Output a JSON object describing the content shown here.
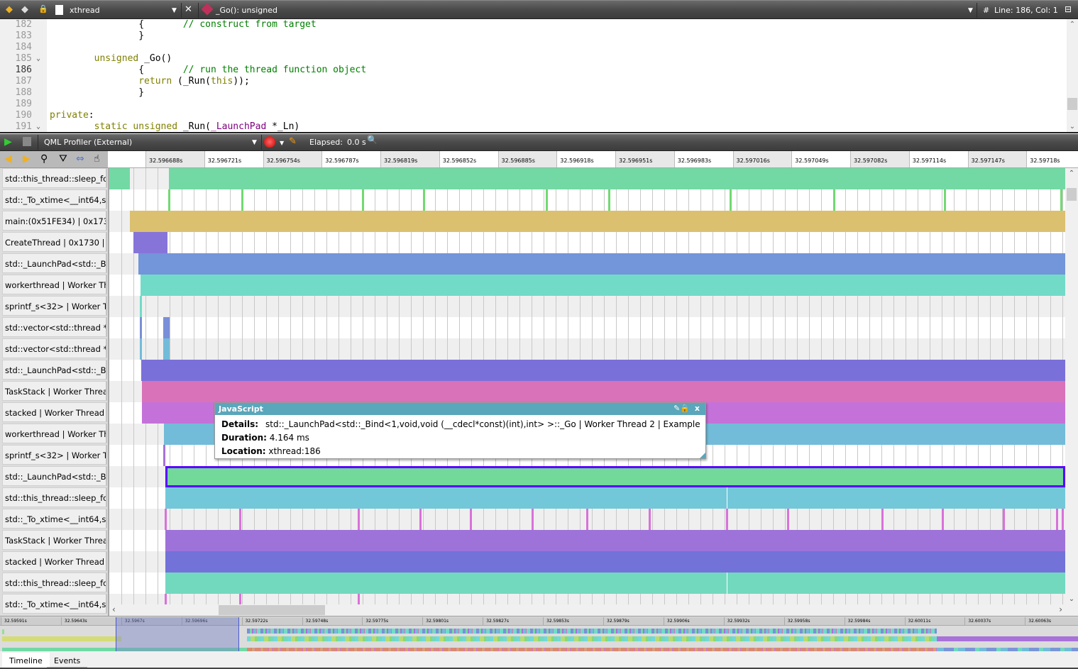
{
  "editor": {
    "file_name": "xthread",
    "symbol": "_Go(): unsigned",
    "position": "Line: 186, Col: 1",
    "hash": "#",
    "lines": [
      {
        "n": "182",
        "fold": false,
        "seg": [
          [
            "",
            "                "
          ],
          [
            "",
            "{"
          ],
          [
            "",
            "       "
          ],
          [
            "cm",
            "// construct from target"
          ]
        ]
      },
      {
        "n": "183",
        "fold": false,
        "seg": [
          [
            "",
            "                "
          ],
          [
            "",
            "}"
          ]
        ]
      },
      {
        "n": "184",
        "fold": false,
        "seg": []
      },
      {
        "n": "185",
        "fold": true,
        "seg": [
          [
            "",
            "        "
          ],
          [
            "kw",
            "unsigned"
          ],
          [
            "",
            " _Go()"
          ]
        ]
      },
      {
        "n": "186",
        "fold": false,
        "seg": [
          [
            "",
            "                "
          ],
          [
            "",
            "{"
          ],
          [
            "",
            "       "
          ],
          [
            "cm",
            "// run the thread function object"
          ]
        ]
      },
      {
        "n": "187",
        "fold": false,
        "seg": [
          [
            "",
            "                "
          ],
          [
            "kw",
            "return"
          ],
          [
            "",
            " (_Run("
          ],
          [
            "kw",
            "this"
          ],
          [
            "",
            "));"
          ]
        ]
      },
      {
        "n": "188",
        "fold": false,
        "seg": [
          [
            "",
            "                "
          ],
          [
            "",
            "}"
          ]
        ]
      },
      {
        "n": "189",
        "fold": false,
        "seg": []
      },
      {
        "n": "190",
        "fold": false,
        "seg": [
          [
            "kw",
            "private"
          ],
          [
            "",
            ":"
          ]
        ]
      },
      {
        "n": "191",
        "fold": true,
        "seg": [
          [
            "",
            "        "
          ],
          [
            "kw",
            "static unsigned"
          ],
          [
            "",
            " _Run("
          ],
          [
            "ty",
            "_LaunchPad"
          ],
          [
            "",
            " *_Ln)"
          ]
        ]
      }
    ]
  },
  "profiler": {
    "title": "QML Profiler (External)",
    "elapsed_label": "Elapsed:",
    "elapsed_value": "0.0 s",
    "ticks": [
      "56s",
      "32.596688s",
      "32.596721s",
      "32.596754s",
      "32.596787s",
      "32.596819s",
      "32.596852s",
      "32.596885s",
      "32.596918s",
      "32.596951s",
      "32.596983s",
      "32.597016s",
      "32.597049s",
      "32.597082s",
      "32.597114s",
      "32.597147s",
      "32.59718s"
    ],
    "rows": [
      {
        "label": "std::this_thread::sleep_for...",
        "color": "#72d9a4",
        "bars": [
          [
            32.5966677,
            32.5966792
          ],
          [
            32.5967012,
            32.597205
          ]
        ]
      },
      {
        "label": "std::_To_xtime<__int64,st...",
        "color": "#72d972",
        "marks": [
          32.5967012,
          32.5967422,
          32.59681,
          32.5968443,
          32.5969133,
          32.5969484,
          32.5970166,
          32.5970748,
          32.597137,
          32.5972025
        ]
      },
      {
        "label": "main:(0x51FE34) | 0x1730 ...",
        "color": "#dbc070",
        "bars": [
          [
            32.5966792,
            32.597205
          ]
        ]
      },
      {
        "label": "CreateThread | 0x1730 | E...",
        "color": "#8674d9",
        "bars": [
          [
            32.5966812,
            32.5967004
          ]
        ]
      },
      {
        "label": "std::_LaunchPad<std::_Bin...",
        "color": "#7395d9",
        "bars": [
          [
            32.596684,
            32.597205
          ]
        ]
      },
      {
        "label": "workerthread | Worker Thr...",
        "color": "#72dbc8",
        "bars": [
          [
            32.5966852,
            32.597205
          ]
        ]
      },
      {
        "label": "sprintf_s<32> | Worker Th...",
        "color": "#72dbc8",
        "marks": [
          32.5966852
        ]
      },
      {
        "label": "std::vector<std::thread *,...",
        "color": "#7a8fd9",
        "marks": [
          32.5966852,
          32.5966984,
          32.5966996,
          32.5967008
        ]
      },
      {
        "label": "std::vector<std::thread *,...",
        "color": "#72bcd9",
        "marks": [
          32.5966852,
          32.5966984,
          32.5966996,
          32.5967008
        ]
      },
      {
        "label": "std::_LaunchPad<std::_Bin...",
        "color": "#7a70d9",
        "bars": [
          [
            32.5966856,
            32.597205
          ]
        ]
      },
      {
        "label": "TaskStack | Worker Thread...",
        "color": "#d972b8",
        "bars": [
          [
            32.596686,
            32.597205
          ]
        ]
      },
      {
        "label": "stacked | Worker Thread 0 ...",
        "color": "#c472d9",
        "bars": [
          [
            32.596686,
            32.597205
          ]
        ]
      },
      {
        "label": "workerthread | Worker Thr...",
        "color": "#72bcd9",
        "bars": [
          [
            32.5966984,
            32.597205
          ]
        ]
      },
      {
        "label": "sprintf_s<32> | Worker Th...",
        "color": "#a872d9",
        "marks": [
          32.5966984
        ]
      },
      {
        "label": "std::_LaunchPad<std::_Bin...",
        "color": "#72d99a",
        "selected": true,
        "bars": [
          [
            32.5966992,
            32.597205
          ]
        ]
      },
      {
        "label": "std::this_thread::sleep_for...",
        "color": "#72c8d9",
        "bars": [
          [
            32.5966992,
            32.5970146
          ],
          [
            32.597015,
            32.597205
          ]
        ]
      },
      {
        "label": "std::_To_xtime<__int64,st...",
        "color": "#d972d9",
        "marks": [
          32.5966992,
          32.596741,
          32.5968076,
          32.5968423,
          32.5968707,
          32.5969053,
          32.5969361,
          32.5969711,
          32.5970146,
          32.5970489,
          32.597102,
          32.5971359,
          32.5971702,
          32.5972001,
          32.5972033
        ]
      },
      {
        "label": "TaskStack | Worker Thread...",
        "color": "#9d72d9",
        "bars": [
          [
            32.5966992,
            32.597205
          ]
        ]
      },
      {
        "label": "stacked | Worker Thread 1 ...",
        "color": "#7272d9",
        "bars": [
          [
            32.5966992,
            32.597205
          ]
        ]
      },
      {
        "label": "std::this_thread::sleep_for...",
        "color": "#72d9bf",
        "bars": [
          [
            32.5966992,
            32.5970146
          ],
          [
            32.597015,
            32.597205
          ]
        ]
      },
      {
        "label": "std::_To_xtime<__int64,st...",
        "color": "#d972d9",
        "marks": [
          32.5966992,
          32.596741,
          32.5968076
        ]
      }
    ],
    "tooltip": {
      "title": "JavaScript",
      "details_label": "Details:",
      "details": "std::_LaunchPad<std::_Bind<1,void,void (__cdecl*const)(int),int> >::_Go | Worker Thread 2 | Example",
      "duration_label": "Duration:",
      "duration": "4.164 ms",
      "location_label": "Location:",
      "location": "xthread:186",
      "close": "x"
    },
    "overview_ticks": [
      "32.59591s",
      "32.59643s",
      "32.5967s",
      "32.59696s",
      "32.59722s",
      "32.59748s",
      "32.59775s",
      "32.59801s",
      "32.59827s",
      "32.59853s",
      "32.59879s",
      "32.59906s",
      "32.59932s",
      "32.59958s",
      "32.59984s",
      "32.60011s",
      "32.60037s",
      "32.60063s"
    ],
    "tabs": [
      "Timeline",
      "Events"
    ],
    "selected_color": "#5a00ff"
  }
}
